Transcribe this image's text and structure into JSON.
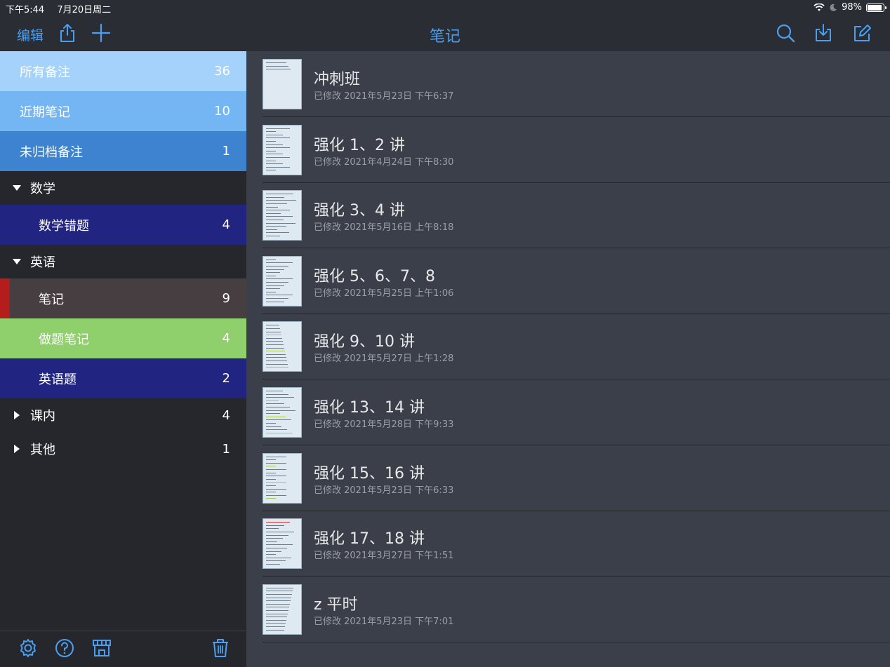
{
  "status": {
    "time": "下午5:44",
    "date": "7月20日周二",
    "battery": "98%"
  },
  "nav": {
    "edit": "编辑",
    "title": "笔记"
  },
  "colors": {
    "accent": "#4a9ff2"
  },
  "sidebar": {
    "rows": [
      {
        "label": "所有备注",
        "count": "36",
        "bg": "#a5d2fb",
        "indent": false
      },
      {
        "label": "近期笔记",
        "count": "10",
        "bg": "#74b6f3",
        "indent": false
      },
      {
        "label": "未归档备注",
        "count": "1",
        "bg": "#3d83cf",
        "indent": false
      },
      {
        "label": "数学",
        "count": "",
        "bg": "",
        "folder": "open"
      },
      {
        "label": "数学错题",
        "count": "4",
        "bg": "#222482",
        "indent": true
      },
      {
        "label": "英语",
        "count": "",
        "bg": "",
        "folder": "open"
      },
      {
        "label": "笔记",
        "count": "9",
        "bg": "#463e41",
        "indent": true,
        "marker": "#b51d1d"
      },
      {
        "label": "做题笔记",
        "count": "4",
        "bg": "#8fcf6c",
        "indent": true
      },
      {
        "label": "英语题",
        "count": "2",
        "bg": "#222482",
        "indent": true
      },
      {
        "label": "课内",
        "count": "4",
        "bg": "",
        "folder": "closed"
      },
      {
        "label": "其他",
        "count": "1",
        "bg": "",
        "folder": "closed"
      }
    ]
  },
  "notes": [
    {
      "title": "冲刺班",
      "date": "已修改 2021年5月23日 下午6:37"
    },
    {
      "title": "强化 1、2 讲",
      "date": "已修改 2021年4月24日 下午8:30"
    },
    {
      "title": "强化 3、4 讲",
      "date": "已修改 2021年5月16日 上午8:18"
    },
    {
      "title": "强化 5、6、7、8",
      "date": "已修改 2021年5月25日 上午1:06"
    },
    {
      "title": "强化 9、10 讲",
      "date": "已修改 2021年5月27日 上午1:28"
    },
    {
      "title": "强化 13、14 讲",
      "date": "已修改 2021年5月28日 下午9:33"
    },
    {
      "title": "强化 15、16 讲",
      "date": "已修改 2021年5月23日 下午6:33"
    },
    {
      "title": "强化 17、18 讲",
      "date": "已修改 2021年3月27日 下午1:51"
    },
    {
      "title": "z 平时",
      "date": "已修改 2021年5月23日 下午7:01"
    }
  ]
}
